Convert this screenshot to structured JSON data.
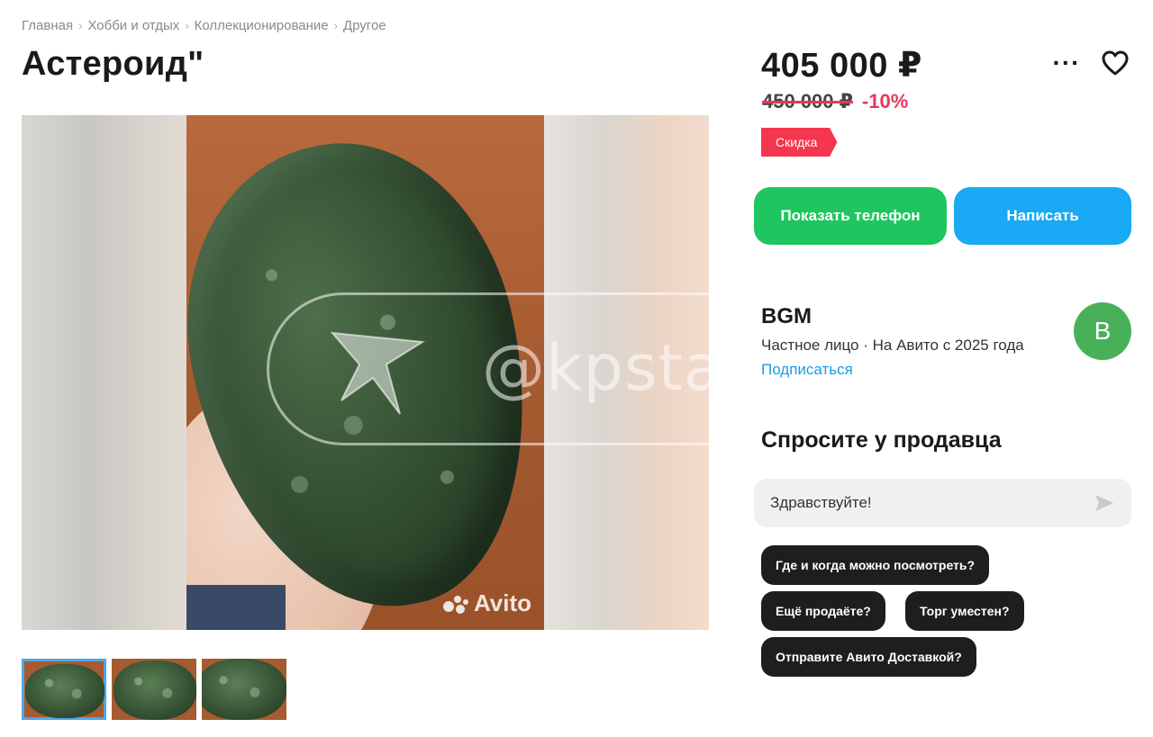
{
  "breadcrumb": [
    {
      "label": "Главная"
    },
    {
      "label": "Хобби и отдых"
    },
    {
      "label": "Коллекционирование"
    },
    {
      "label": "Другое"
    }
  ],
  "breadcrumb_separator": "›",
  "title": "Астероид\"",
  "price": {
    "current": "405 000 ₽",
    "old": "450 000 ₽",
    "discount_percent": "-10%",
    "badge": "Скидка"
  },
  "actions": {
    "more_icon": "more-horizontal-icon",
    "favorite_icon": "heart-icon",
    "show_phone": "Показать телефон",
    "write": "Написать"
  },
  "seller": {
    "name": "BGM",
    "meta": "Частное лицо · На Авито с 2025 года",
    "subscribe": "Подписаться",
    "avatar_letter": "B",
    "avatar_color": "#49b05a"
  },
  "ask": {
    "title": "Спросите у продавца",
    "input_value": "Здравствуйте!",
    "quick_replies": [
      "Где и когда можно посмотреть?",
      "Ещё продаёте?",
      "Торг уместен?",
      "Отправите Авито Доставкой?"
    ]
  },
  "gallery": {
    "thumbnail_count": 3,
    "active_thumbnail": 1,
    "photo_watermark": "Avito"
  },
  "watermark": {
    "text": "@kpstav"
  },
  "colors": {
    "green_button": "#1fc65f",
    "blue_button": "#1aa9f5",
    "discount_red": "#f5364f",
    "link_blue": "#1a9be8"
  }
}
